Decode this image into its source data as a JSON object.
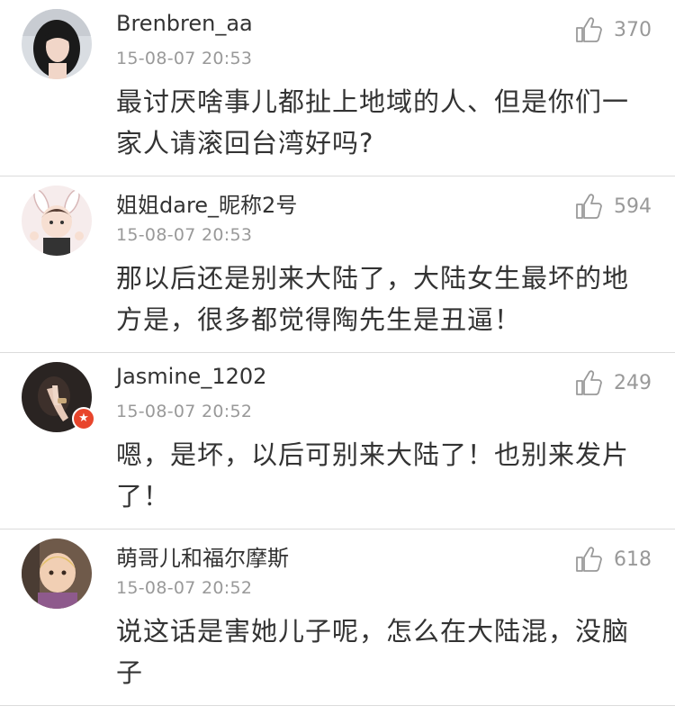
{
  "comments": [
    {
      "username": "Brenbren_aa",
      "time": "15-08-07 20:53",
      "likes": "370",
      "text": "最讨厌啥事儿都扯上地域的人、但是你们一家人请滚回台湾好吗?"
    },
    {
      "username": "姐姐dare_昵称2号",
      "time": "15-08-07 20:53",
      "likes": "594",
      "text": "那以后还是别来大陆了，大陆女生最坏的地方是，很多都觉得陶先生是丑逼！"
    },
    {
      "username": "Jasmine_1202",
      "time": "15-08-07 20:52",
      "likes": "249",
      "text": "嗯，是坏，以后可别来大陆了！也别来发片了！"
    },
    {
      "username": "萌哥儿和福尔摩斯",
      "time": "15-08-07 20:52",
      "likes": "618",
      "text": "说这话是害她儿子呢，怎么在大陆混，没脑子"
    }
  ],
  "icons": {
    "like": "thumbs-up-icon",
    "badge": "star-badge-icon"
  },
  "colors": {
    "badge": "#e8452c",
    "text": "#333333",
    "meta": "#999999"
  }
}
